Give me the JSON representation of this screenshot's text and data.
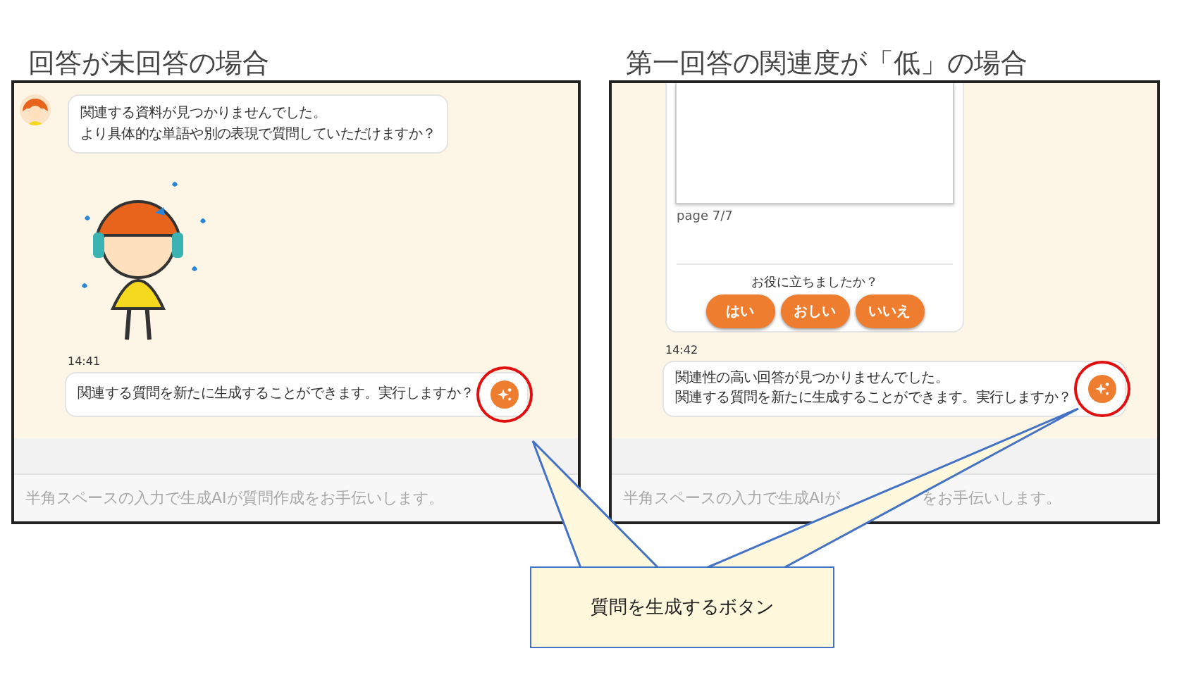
{
  "panels": [
    {
      "title": "回答が未回答の場合",
      "messages": [
        {
          "kind": "bot",
          "lines": [
            "関連する資料が見つかりませんでした。",
            "より具体的な単語や別の表現で質問していただけますか？"
          ]
        },
        {
          "kind": "sticker"
        },
        {
          "kind": "time",
          "text": "14:41"
        },
        {
          "kind": "suggest",
          "lines": [
            "関連する質問を新たに生成することができます。実行しますか？"
          ]
        }
      ],
      "placeholder_parts": [
        "半角スペースの入力で生成AIが質問作成をお手伝いします。"
      ]
    },
    {
      "title": "第一回答の関連度が「低」の場合",
      "messages": [
        {
          "kind": "answer_card",
          "page": "page 7/7",
          "question": "お役に立ちましたか？",
          "buttons": [
            "はい",
            "おしい",
            "いいえ"
          ]
        },
        {
          "kind": "time",
          "text": "14:42"
        },
        {
          "kind": "suggest",
          "lines": [
            "関連性の高い回答が見つかりませんでした。",
            "関連する質問を新たに生成することができます。実行しますか？"
          ]
        }
      ],
      "placeholder_parts": [
        "半角スペースの入力で生成AIが",
        "をお手伝いします。"
      ]
    }
  ],
  "callout": {
    "text": "質問を生成するボタン"
  }
}
